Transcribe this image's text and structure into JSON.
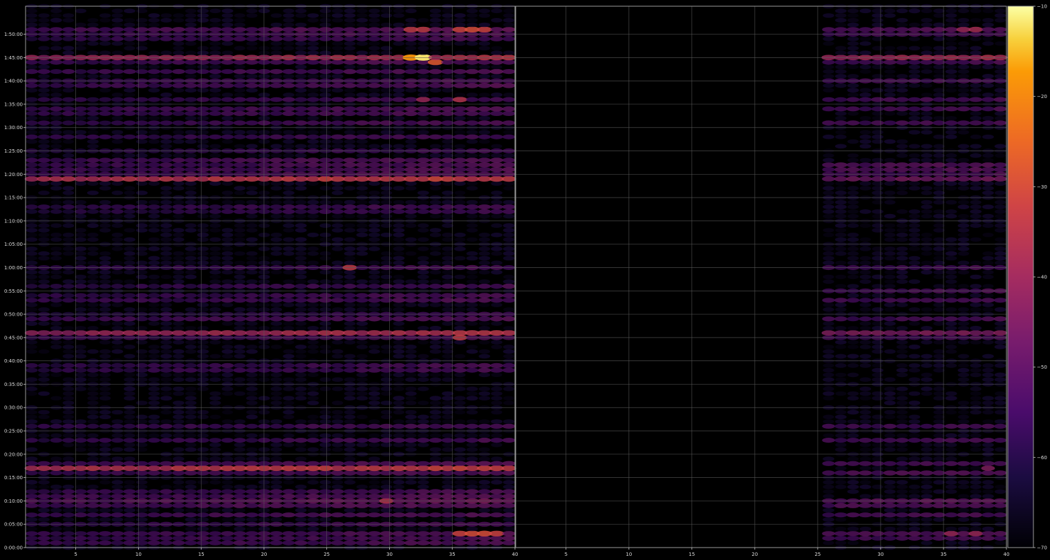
{
  "chart_data": [
    {
      "type": "heatmap",
      "panel": "left",
      "colormap": "inferno",
      "background": "#000000",
      "grid": true,
      "xlim": [
        1,
        40
      ],
      "ylim": [
        0,
        6960
      ],
      "x_ticks": [
        5,
        10,
        15,
        20,
        25,
        30,
        35,
        40
      ],
      "x_tick_labels": [
        "5",
        "10",
        "15",
        "20",
        "25",
        "30",
        "35",
        "40"
      ],
      "y_ticks": [
        0,
        300,
        600,
        900,
        1200,
        1500,
        1800,
        2100,
        2400,
        2700,
        3000,
        3300,
        3600,
        3900,
        4200,
        4500,
        4800,
        5100,
        5400,
        5700,
        6000,
        6300,
        6600
      ],
      "y_tick_labels": [
        "0:00:00",
        "0:05:00",
        "0:10:00",
        "0:15:00",
        "0:20:00",
        "0:25:00",
        "0:30:00",
        "0:35:00",
        "0:40:00",
        "0:45:00",
        "0:50:00",
        "0:55:00",
        "1:00:00",
        "1:05:00",
        "1:10:00",
        "1:15:00",
        "1:20:00",
        "1:25:00",
        "1:30:00",
        "1:35:00",
        "1:40:00",
        "1:45:00",
        "1:50:00"
      ],
      "bin_x": [
        1,
        40,
        1
      ],
      "bin_y": [
        0,
        6960,
        60
      ],
      "level_range": [
        -70,
        -10
      ],
      "bright_rows": [
        {
          "t": 6660,
          "level": -54
        },
        {
          "t": 6600,
          "level": -56
        },
        {
          "t": 6540,
          "level": -58
        },
        {
          "t": 6300,
          "level": -42
        },
        {
          "t": 6240,
          "level": -56
        },
        {
          "t": 6120,
          "level": -56
        },
        {
          "t": 6000,
          "level": -57
        },
        {
          "t": 5940,
          "level": -56
        },
        {
          "t": 5760,
          "level": -58
        },
        {
          "t": 5640,
          "level": -56
        },
        {
          "t": 5580,
          "level": -57
        },
        {
          "t": 5460,
          "level": -57
        },
        {
          "t": 5280,
          "level": -58
        },
        {
          "t": 5100,
          "level": -60
        },
        {
          "t": 4980,
          "level": -55
        },
        {
          "t": 4920,
          "level": -56
        },
        {
          "t": 4860,
          "level": -56
        },
        {
          "t": 4800,
          "level": -55
        },
        {
          "t": 4740,
          "level": -38
        },
        {
          "t": 4380,
          "level": -58
        },
        {
          "t": 4320,
          "level": -60
        },
        {
          "t": 3600,
          "level": -58
        },
        {
          "t": 3360,
          "level": -58
        },
        {
          "t": 3240,
          "level": -58
        },
        {
          "t": 3180,
          "level": -57
        },
        {
          "t": 3000,
          "level": -60
        },
        {
          "t": 2940,
          "level": -56
        },
        {
          "t": 2760,
          "level": -42
        },
        {
          "t": 2700,
          "level": -57
        },
        {
          "t": 2340,
          "level": -58
        },
        {
          "t": 2280,
          "level": -58
        },
        {
          "t": 1560,
          "level": -57
        },
        {
          "t": 1380,
          "level": -58
        },
        {
          "t": 1080,
          "level": -55
        },
        {
          "t": 1020,
          "level": -38
        },
        {
          "t": 960,
          "level": -56
        },
        {
          "t": 720,
          "level": -57
        },
        {
          "t": 660,
          "level": -55
        },
        {
          "t": 600,
          "level": -52
        },
        {
          "t": 540,
          "level": -54
        },
        {
          "t": 420,
          "level": -56
        },
        {
          "t": 300,
          "level": -58
        },
        {
          "t": 180,
          "level": -56
        },
        {
          "t": 120,
          "level": -57
        },
        {
          "t": 60,
          "level": -56
        }
      ],
      "hot_spots": [
        {
          "x": 33,
          "t": 6300,
          "level": -12
        },
        {
          "x": 32,
          "t": 6300,
          "level": -18
        },
        {
          "x": 34,
          "t": 6240,
          "level": -28
        },
        {
          "x": 37,
          "t": 6660,
          "level": -30
        },
        {
          "x": 38,
          "t": 6660,
          "level": -32
        },
        {
          "x": 36,
          "t": 6660,
          "level": -32
        },
        {
          "x": 32,
          "t": 6660,
          "level": -34
        },
        {
          "x": 33,
          "t": 6660,
          "level": -34
        },
        {
          "x": 36,
          "t": 5760,
          "level": -36
        },
        {
          "x": 33,
          "t": 5760,
          "level": -40
        },
        {
          "x": 36,
          "t": 4740,
          "level": -34
        },
        {
          "x": 37,
          "t": 4740,
          "level": -36
        },
        {
          "x": 27,
          "t": 3600,
          "level": -34
        },
        {
          "x": 36,
          "t": 2700,
          "level": -34
        },
        {
          "x": 37,
          "t": 180,
          "level": -30
        },
        {
          "x": 38,
          "t": 180,
          "level": -30
        },
        {
          "x": 39,
          "t": 180,
          "level": -32
        },
        {
          "x": 36,
          "t": 180,
          "level": -32
        },
        {
          "x": 30,
          "t": 600,
          "level": -36
        },
        {
          "x": 12,
          "t": 1020,
          "level": -38
        }
      ]
    },
    {
      "type": "heatmap",
      "panel": "right",
      "colormap": "inferno",
      "background": "#000000",
      "grid": true,
      "xlim": [
        1,
        40
      ],
      "ylim": [
        0,
        6960
      ],
      "x_ticks": [
        5,
        10,
        15,
        20,
        25,
        30,
        35,
        40
      ],
      "x_tick_labels": [
        "5",
        "10",
        "15",
        "20",
        "25",
        "30",
        "35",
        "40"
      ],
      "bin_x": [
        1,
        40,
        1
      ],
      "bin_y": [
        0,
        6960,
        60
      ],
      "active_x_from": 26,
      "level_range": [
        -70,
        -10
      ],
      "bright_rows": [
        {
          "t": 6660,
          "level": -56
        },
        {
          "t": 6600,
          "level": -58
        },
        {
          "t": 6300,
          "level": -44
        },
        {
          "t": 6240,
          "level": -58
        },
        {
          "t": 6000,
          "level": -58
        },
        {
          "t": 5760,
          "level": -58
        },
        {
          "t": 5640,
          "level": -58
        },
        {
          "t": 5460,
          "level": -58
        },
        {
          "t": 4920,
          "level": -56
        },
        {
          "t": 4860,
          "level": -56
        },
        {
          "t": 4800,
          "level": -58
        },
        {
          "t": 4740,
          "level": -52
        },
        {
          "t": 3600,
          "level": -58
        },
        {
          "t": 3300,
          "level": -58
        },
        {
          "t": 3180,
          "level": -58
        },
        {
          "t": 2940,
          "level": -58
        },
        {
          "t": 2760,
          "level": -50
        },
        {
          "t": 2700,
          "level": -58
        },
        {
          "t": 1560,
          "level": -58
        },
        {
          "t": 1380,
          "level": -58
        },
        {
          "t": 1080,
          "level": -58
        },
        {
          "t": 960,
          "level": -56
        },
        {
          "t": 600,
          "level": -54
        },
        {
          "t": 540,
          "level": -56
        },
        {
          "t": 420,
          "level": -58
        },
        {
          "t": 180,
          "level": -56
        },
        {
          "t": 120,
          "level": -58
        }
      ],
      "hot_spots": [
        {
          "x": 32,
          "t": 6300,
          "level": -38
        },
        {
          "x": 33,
          "t": 6300,
          "level": -40
        },
        {
          "x": 38,
          "t": 6660,
          "level": -38
        },
        {
          "x": 37,
          "t": 6660,
          "level": -40
        },
        {
          "x": 36,
          "t": 180,
          "level": -40
        },
        {
          "x": 38,
          "t": 180,
          "level": -40
        },
        {
          "x": 39,
          "t": 1020,
          "level": -44
        }
      ]
    }
  ],
  "colorbar": {
    "colormap": "inferno",
    "range": [
      -70,
      -10
    ],
    "ticks": [
      -70,
      -60,
      -50,
      -40,
      -30,
      -20,
      -10
    ],
    "tick_labels": [
      "−70",
      "−60",
      "−50",
      "−40",
      "−30",
      "−20",
      "−10"
    ]
  }
}
